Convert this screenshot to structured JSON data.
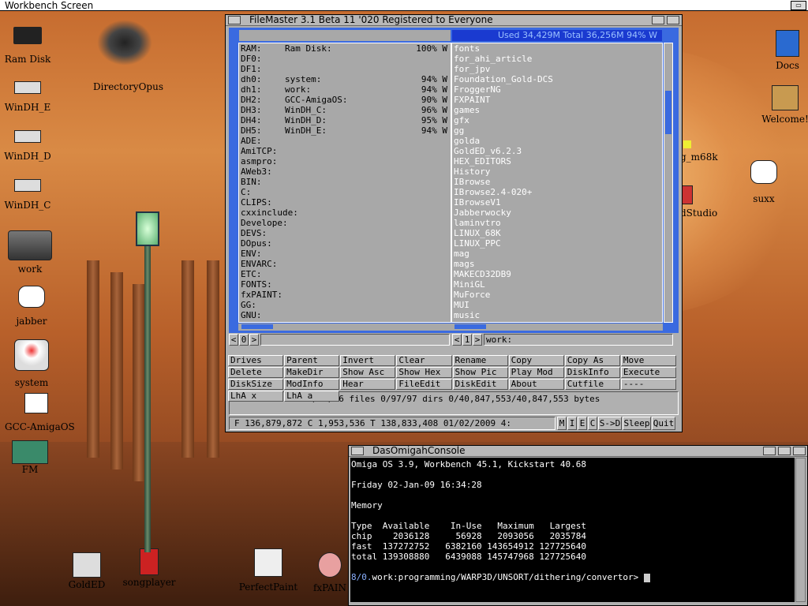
{
  "screen": {
    "title": "Workbench Screen"
  },
  "desktop_icons": [
    {
      "label": "Ram Disk",
      "icon": "ram-chip-icon"
    },
    {
      "label": "DirectoryOpus",
      "icon": "winged-figure-icon"
    },
    {
      "label": "WinDH_E",
      "icon": "drive-icon"
    },
    {
      "label": "WinDH_D",
      "icon": "drive-icon"
    },
    {
      "label": "WinDH_C",
      "icon": "drive-icon"
    },
    {
      "label": "work",
      "icon": "harddisk-icon"
    },
    {
      "label": "jabber",
      "icon": "speech-bubble-icon"
    },
    {
      "label": "system",
      "icon": "boing-ball-drive-icon"
    },
    {
      "label": "GCC-AmigaOS",
      "icon": "computer-icon"
    },
    {
      "label": "FM",
      "icon": "filemanager-icon"
    },
    {
      "label": "GoldED",
      "icon": "typewriter-icon"
    },
    {
      "label": "songplayer",
      "icon": "speaker-icon"
    },
    {
      "label": "PerfectPaint",
      "icon": "paint-brush-icon"
    },
    {
      "label": "fxPAIN",
      "icon": "palette-icon"
    },
    {
      "label": "Docs",
      "icon": "cube-icon"
    },
    {
      "label": "Welcome!",
      "icon": "box-icon"
    },
    {
      "label": "g_m68k",
      "icon": "star-icon"
    },
    {
      "label": "dStudio",
      "icon": "studio-icon"
    },
    {
      "label": "suxx",
      "icon": "speech-bubble-icon"
    }
  ],
  "filemaster": {
    "title": "FileMaster 3.1 Beta 11 '020 Registered to Everyone",
    "right_header": "Used 34,429M Total 36,256M 94% W",
    "left_list": [
      {
        "name": "RAM:",
        "vol": "Ram Disk:",
        "pct": "100% W"
      },
      {
        "name": "DF0:",
        "vol": "",
        "pct": ""
      },
      {
        "name": "DF1:",
        "vol": "",
        "pct": ""
      },
      {
        "name": "dh0:",
        "vol": "system:",
        "pct": "94% W"
      },
      {
        "name": "dh1:",
        "vol": "work:",
        "pct": "94% W"
      },
      {
        "name": "DH2:",
        "vol": "GCC-AmigaOS:",
        "pct": "90% W"
      },
      {
        "name": "DH3:",
        "vol": "WinDH_C:",
        "pct": "96% W"
      },
      {
        "name": "DH4:",
        "vol": "WinDH_D:",
        "pct": "95% W"
      },
      {
        "name": "DH5:",
        "vol": "WinDH_E:",
        "pct": "94% W"
      },
      {
        "name": "ADE:",
        "vol": "",
        "pct": ""
      },
      {
        "name": "AmiTCP:",
        "vol": "",
        "pct": ""
      },
      {
        "name": "asmpro:",
        "vol": "",
        "pct": ""
      },
      {
        "name": "AWeb3:",
        "vol": "",
        "pct": ""
      },
      {
        "name": "BIN:",
        "vol": "",
        "pct": ""
      },
      {
        "name": "C:",
        "vol": "",
        "pct": ""
      },
      {
        "name": "CLIPS:",
        "vol": "",
        "pct": ""
      },
      {
        "name": "cxxinclude:",
        "vol": "",
        "pct": ""
      },
      {
        "name": "Develope:",
        "vol": "",
        "pct": ""
      },
      {
        "name": "DEVS:",
        "vol": "",
        "pct": ""
      },
      {
        "name": "DOpus:",
        "vol": "",
        "pct": ""
      },
      {
        "name": "ENV:",
        "vol": "",
        "pct": ""
      },
      {
        "name": "ENVARC:",
        "vol": "",
        "pct": ""
      },
      {
        "name": "ETC:",
        "vol": "",
        "pct": ""
      },
      {
        "name": "FONTS:",
        "vol": "",
        "pct": ""
      },
      {
        "name": "fxPAINT:",
        "vol": "",
        "pct": ""
      },
      {
        "name": "GG:",
        "vol": "",
        "pct": ""
      },
      {
        "name": "GNU:",
        "vol": "",
        "pct": ""
      }
    ],
    "right_list": [
      "fonts",
      "for_ahi_article",
      "for_jpv",
      "Foundation_Gold-DCS",
      "FroggerNG",
      "FXPAINT",
      "games",
      "gfx",
      "gg",
      "golda",
      "GoldED_v6.2.3",
      "HEX_EDITORS",
      "History",
      "IBrowse",
      "IBrowse2.4-020+",
      "IBrowseV1",
      "Jabberwocky",
      "laminvtro",
      "LINUX_68K",
      "LINUX_PPC",
      "mag",
      "mags",
      "MAKECD32DB9",
      "MiniGL",
      "MuForce",
      "MUI",
      "music"
    ],
    "left_nav": {
      "prev": "<",
      "num": "0",
      "next": ">",
      "path": ""
    },
    "right_nav": {
      "prev": "<",
      "num": "1",
      "next": ">",
      "path": "work:"
    },
    "buttons": [
      "Drives",
      "Parent",
      "Invert",
      "Clear",
      "Rename",
      "Copy",
      "Copy As",
      "Move",
      "Delete",
      "MakeDir",
      "Show Asc",
      "Show Hex",
      "Show Pic",
      "Play Mod",
      "DiskInfo",
      "Execute",
      "DiskSize",
      "ModInfo",
      "Hear",
      "FileEdit",
      "DiskEdit",
      "About",
      "Cutfile",
      "----",
      "LhA x",
      "LhA a"
    ],
    "info_line": "0/66/66 files 0/97/97 dirs 0/40,847,553/40,847,553 bytes",
    "status_line": "F  136,879,872 C    1,953,536 T  138,833,408 01/02/2009 4:",
    "status_buttons": [
      "M",
      "I",
      "E",
      "C",
      "S->D",
      "Sleep",
      "Quit"
    ]
  },
  "console": {
    "title": "DasOmigahConsole",
    "lines": [
      "Omiga OS 3.9, Workbench 45.1, Kickstart 40.68",
      "",
      "Friday 02-Jan-09 16:34:28",
      "",
      "Memory",
      "",
      "Type  Available    In-Use   Maximum   Largest",
      "chip    2036128     56928   2093056   2035784",
      "fast  137272752   6382160 143654912 127725640",
      "total 139308880   6439088 145747968 127725640",
      ""
    ],
    "prompt_prefix": "8/0.",
    "prompt_path": "work:programming/WARP3D/UNSORT/dithering/convertor>"
  }
}
